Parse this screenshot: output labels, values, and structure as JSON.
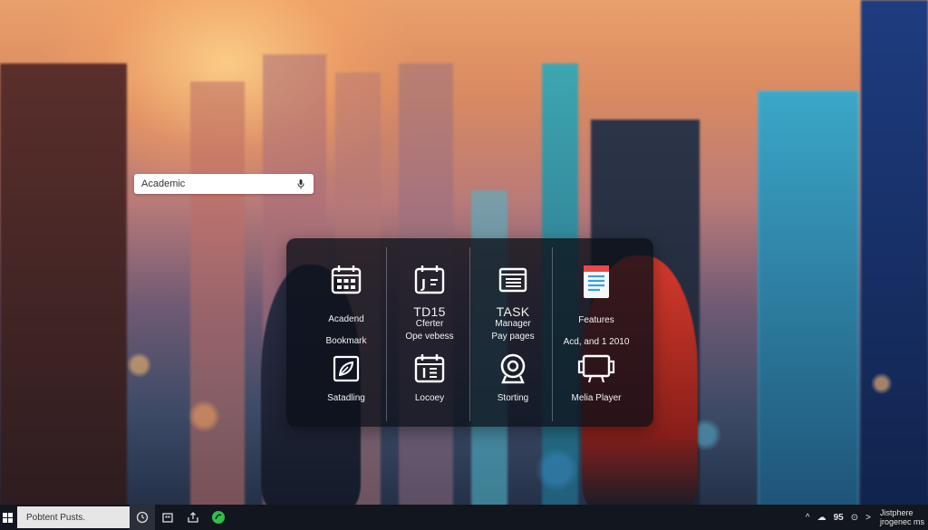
{
  "search": {
    "value": "Academic",
    "icon": "mic-icon"
  },
  "panel": {
    "tiles": [
      {
        "icon": "calendar-grid-icon",
        "line1": "Acadend",
        "line2": "Bookmark"
      },
      {
        "icon": "calendar-j-icon",
        "big": "TD15",
        "line1": "Cferter",
        "line2": "Ope vebess"
      },
      {
        "icon": "list-icon",
        "big": "TASK",
        "line1": "Manager",
        "line2": "Pay pages"
      },
      {
        "icon": "document-icon",
        "line1": "Features",
        "line2": "Acd, and 1 2010"
      },
      {
        "icon": "leaf-icon",
        "line1": "Satadling"
      },
      {
        "icon": "calendar-1e-icon",
        "line1": "Locoey"
      },
      {
        "icon": "webcam-icon",
        "line1": "Storting"
      },
      {
        "icon": "media-player-icon",
        "line1": "Melia Player"
      }
    ]
  },
  "taskbar": {
    "search_text": "Pobtent Pusts.",
    "apps": [
      "circle-clock-icon",
      "store-icon",
      "upload-icon",
      "green-app-icon"
    ],
    "tray": {
      "chevron": "^",
      "a": "☁",
      "b": "95",
      "c": "⊙",
      "d": ">"
    },
    "clock_line1": "Jistphere",
    "clock_line2": "jrogenec ms"
  },
  "colors": {
    "panel_bg": "#0c1018",
    "taskbar_bg": "#12161e",
    "accent_green": "#2fbf4a"
  }
}
